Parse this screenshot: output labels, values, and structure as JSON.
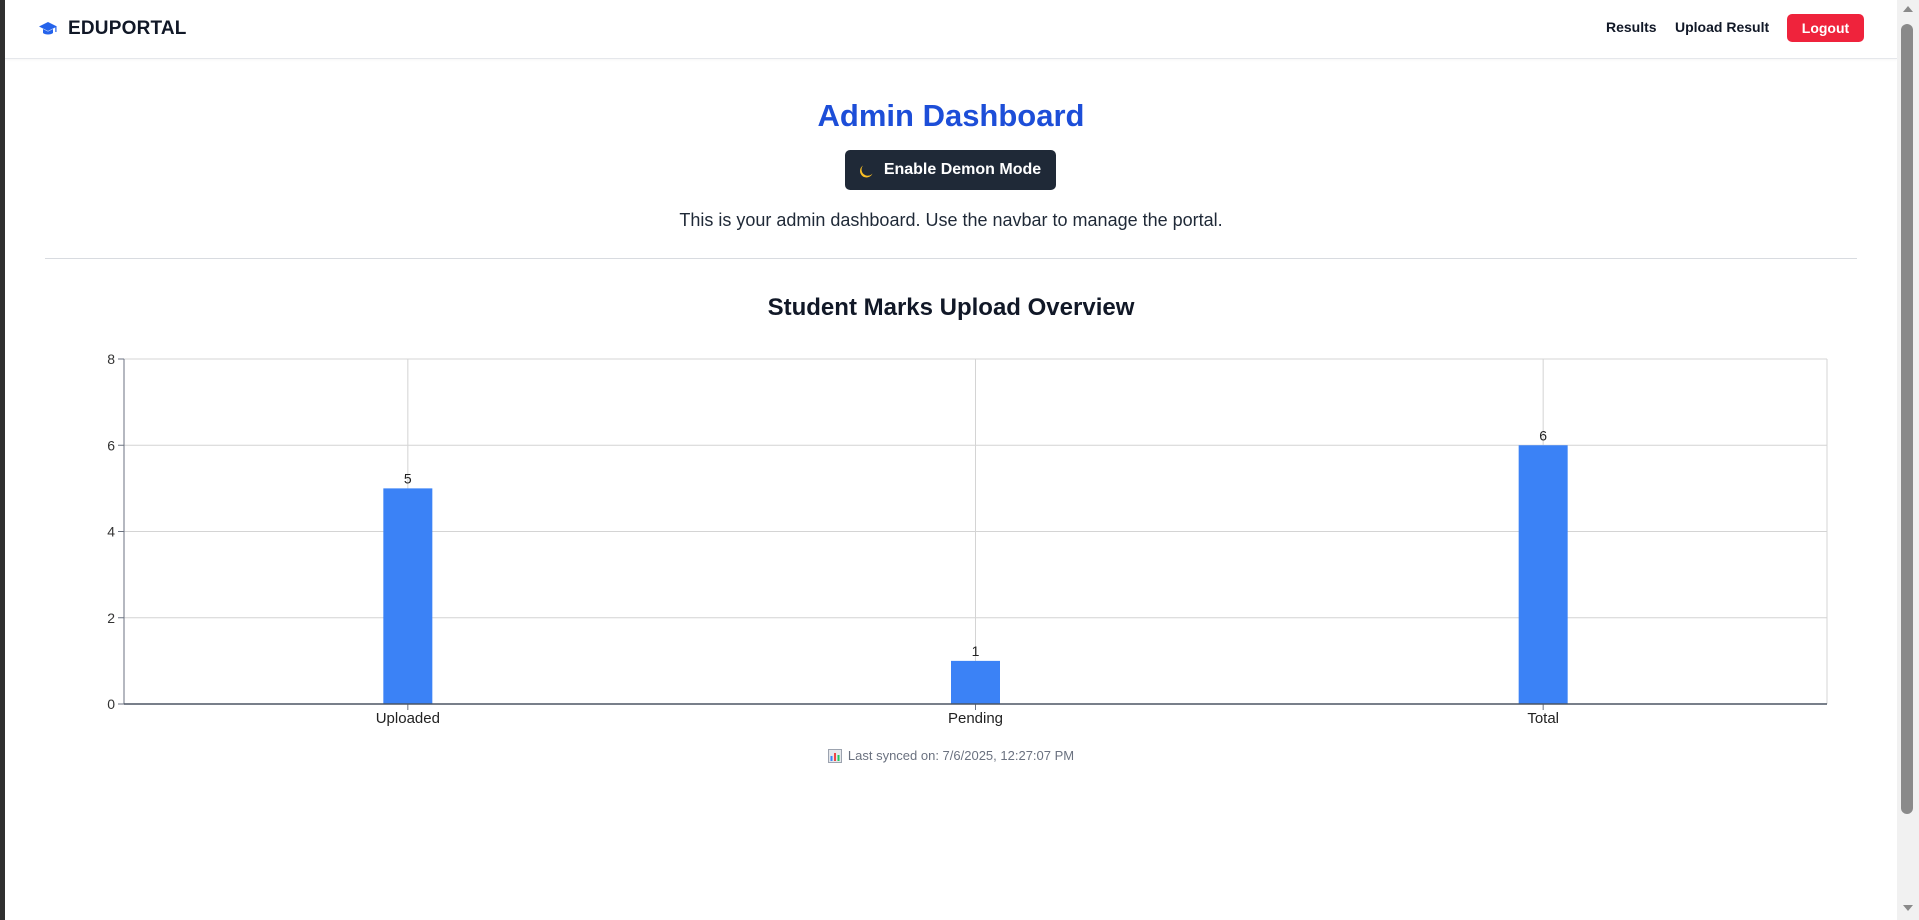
{
  "navbar": {
    "brand": "EDUPORTAL",
    "brand_icon": "graduation-cap-icon",
    "links": [
      {
        "label": "Results"
      },
      {
        "label": "Upload Result"
      }
    ],
    "logout_label": "Logout"
  },
  "page": {
    "title": "Admin Dashboard",
    "demon_button_label": "Enable Demon Mode",
    "demon_button_icon": "moon-icon",
    "intro": "This is your admin dashboard. Use the navbar to manage the portal."
  },
  "chart_data": {
    "type": "bar",
    "title": "Student Marks Upload Overview",
    "categories": [
      "Uploaded",
      "Pending",
      "Total"
    ],
    "values": [
      5,
      1,
      6
    ],
    "ylim": [
      0,
      8
    ],
    "yticks": [
      0,
      2,
      4,
      6,
      8
    ],
    "xlabel": "",
    "ylabel": "",
    "grid": true,
    "bar_color": "#3b82f6"
  },
  "sync": {
    "icon": "bar-chart-icon",
    "text": "Last synced on: 7/6/2025, 12:27:07 PM"
  },
  "colors": {
    "accent": "#1d4ed8",
    "logout": "#ef233c",
    "dark_button": "#1f2937"
  }
}
